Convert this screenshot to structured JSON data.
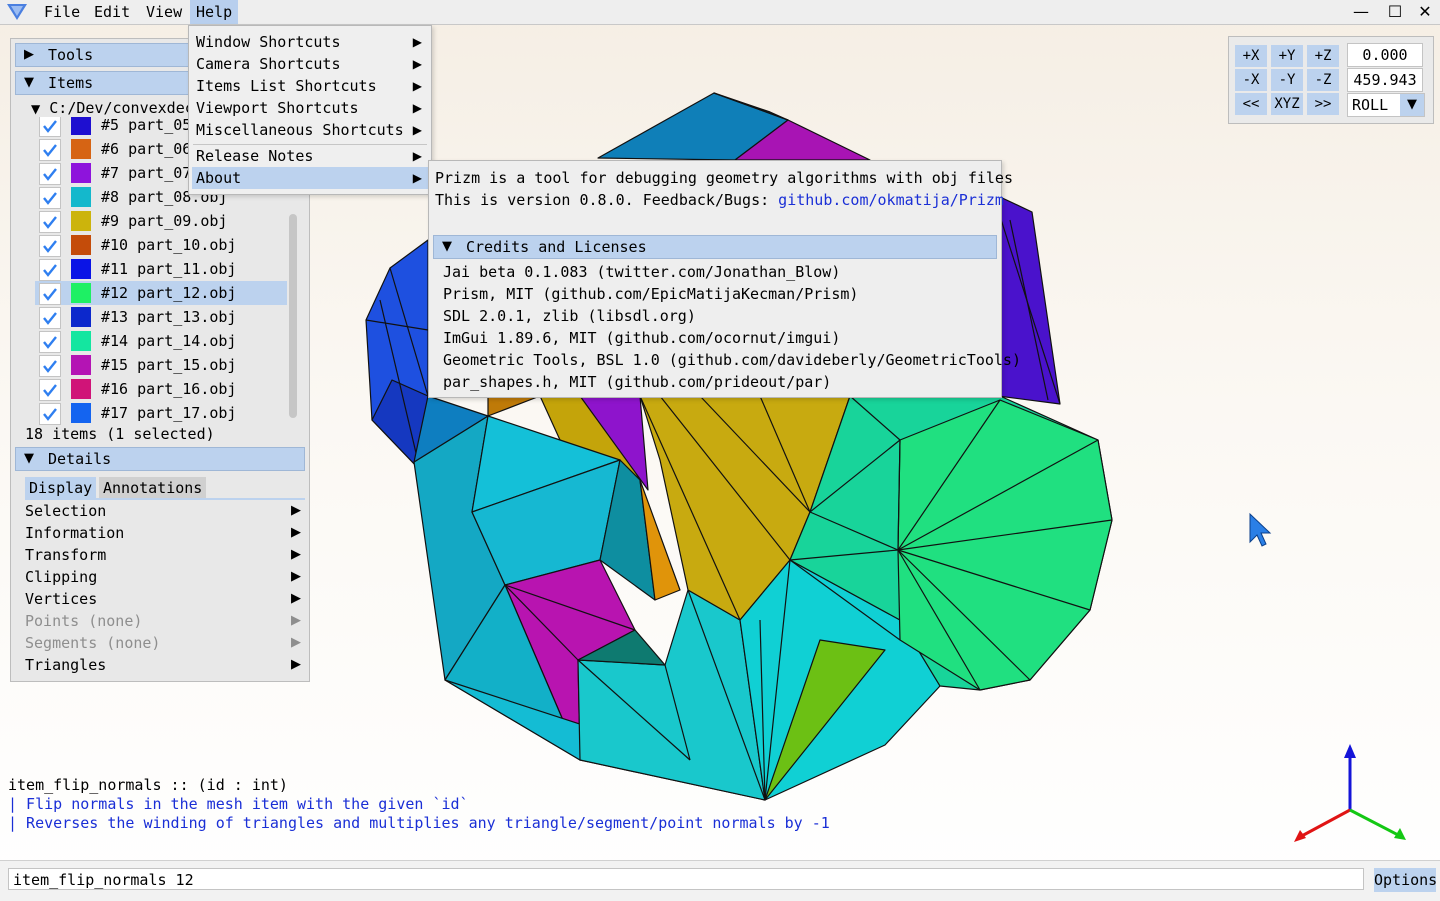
{
  "app": {
    "logo_icon": "prizm-logo-icon"
  },
  "menubar": {
    "file": "File",
    "edit": "Edit",
    "view": "View",
    "help": "Help",
    "window_controls": [
      "minimize-icon",
      "maximize-icon",
      "close-icon"
    ]
  },
  "left_panel": {
    "tools_label": "Tools",
    "items_label": "Items",
    "tree_root": "C:/Dev/convexdec",
    "items": [
      {
        "label": "#5  part_05.obj",
        "color": "#1e0fd0",
        "checked": true
      },
      {
        "label": "#6  part_06.obj",
        "color": "#d66414",
        "checked": true
      },
      {
        "label": "#7  part_07.obj",
        "color": "#8e14dc",
        "checked": true
      },
      {
        "label": "#8  part_08.obj",
        "color": "#14b8cc",
        "checked": true
      },
      {
        "label": "#9  part_09.obj",
        "color": "#ccb40c",
        "checked": true
      },
      {
        "label": "#10 part_10.obj",
        "color": "#c44c0a",
        "checked": true
      },
      {
        "label": "#11 part_11.obj",
        "color": "#0a14e6",
        "checked": true
      },
      {
        "label": "#12 part_12.obj",
        "color": "#1ef064",
        "checked": true,
        "selected": true
      },
      {
        "label": "#13 part_13.obj",
        "color": "#0c28cc",
        "checked": true
      },
      {
        "label": "#14 part_14.obj",
        "color": "#14e6a0",
        "checked": true
      },
      {
        "label": "#15 part_15.obj",
        "color": "#b414b4",
        "checked": true
      },
      {
        "label": "#16 part_16.obj",
        "color": "#d01478",
        "checked": true
      },
      {
        "label": "#17 part_17.obj",
        "color": "#1464f0",
        "checked": true
      }
    ],
    "count_text": "18 items (1 selected)",
    "details_label": "Details",
    "tab_display": "Display",
    "tab_annotations": "Annotations",
    "details_items": [
      {
        "label": "Selection",
        "disabled": false
      },
      {
        "label": "Information",
        "disabled": false
      },
      {
        "label": "Transform",
        "disabled": false
      },
      {
        "label": "Clipping",
        "disabled": false
      },
      {
        "label": "Vertices",
        "disabled": false
      },
      {
        "label": "Points (none)",
        "disabled": true
      },
      {
        "label": "Segments (none)",
        "disabled": true
      },
      {
        "label": "Triangles",
        "disabled": false
      }
    ]
  },
  "help_menu": {
    "items": [
      "Window Shortcuts",
      "Camera Shortcuts",
      "Items List Shortcuts",
      "Viewport Shortcuts",
      "Miscellaneous Shortcuts"
    ],
    "release_notes": "Release Notes",
    "about": "About"
  },
  "about": {
    "line1": "Prizm is a tool for debugging geometry algorithms with obj files",
    "line2_prefix": "This is version 0.8.0. Feedback/Bugs: ",
    "line2_link": "github.com/okmatija/Prizm",
    "credits_label": "Credits and Licenses",
    "licenses": [
      "Jai beta 0.1.083 (twitter.com/Jonathan_Blow)",
      "Prism, MIT (github.com/EpicMatijaKecman/Prism)",
      "SDL 2.0.1, zlib (libsdl.org)",
      "ImGui 1.89.6, MIT (github.com/ocornut/imgui)",
      "Geometric Tools, BSL 1.0 (github.com/davideberly/GeometricTools)",
      "par_shapes.h, MIT (github.com/prideout/par)"
    ]
  },
  "camera": {
    "buttons_row1": [
      "+X",
      "+Y",
      "+Z"
    ],
    "buttons_row2": [
      "-X",
      "-Y",
      "-Z"
    ],
    "buttons_row3": [
      "<<",
      "XYZ",
      ">>"
    ],
    "field1": "0.000",
    "field2": "459.943",
    "mode": "ROLL"
  },
  "console": {
    "signature": "item_flip_normals :: (id : int)",
    "doc1": "| Flip normals in the mesh item with the given `id`",
    "doc2": "| Reverses the winding of triangles and multiplies any triangle/segment/point normals by -1",
    "input_value": "item_flip_normals 12",
    "options_label": "Options"
  },
  "viewport": {
    "cursor_icon": "mouse-pointer-icon",
    "axes_icon": "xyz-axes-gizmo-icon"
  }
}
